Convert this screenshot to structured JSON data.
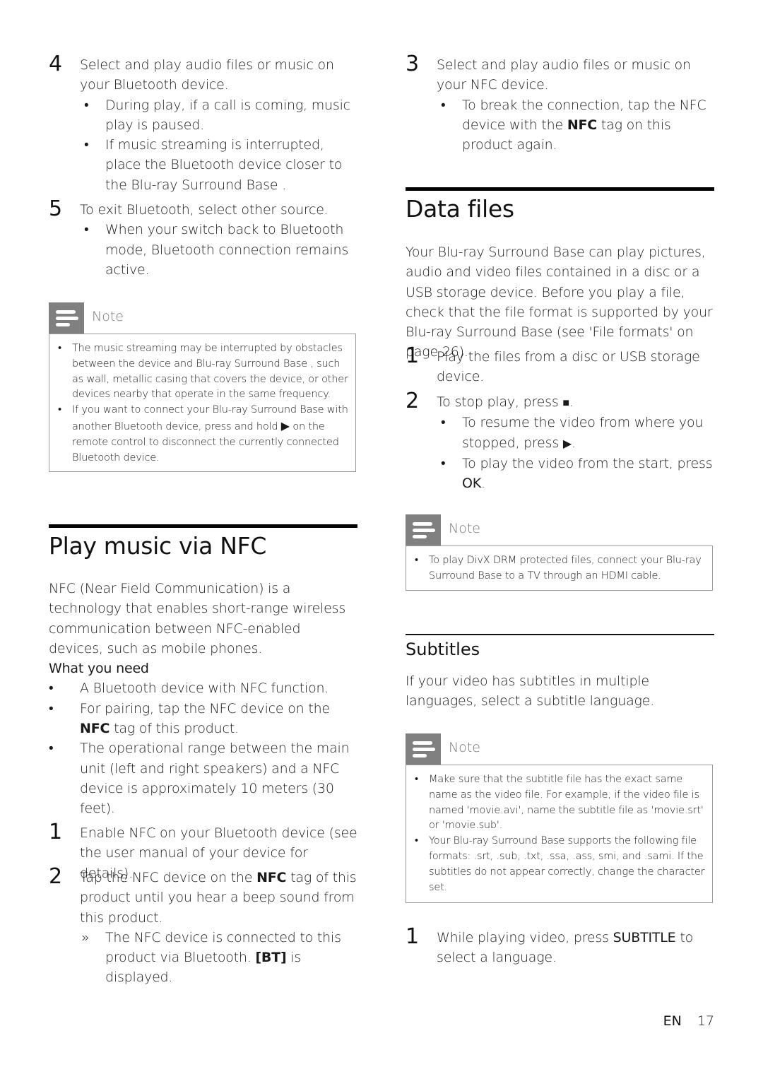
{
  "page": {
    "language_code": "EN",
    "page_number": "17"
  },
  "left": {
    "step4": {
      "num": "4",
      "text": "Select and play audio files or music on your Bluetooth device.",
      "bullets": [
        "During play, if a call is coming, music play is paused.",
        "If music streaming is interrupted, place the Bluetooth device closer to the Blu-ray Surround Base ."
      ]
    },
    "step5": {
      "num": "5",
      "text": "To exit Bluetooth, select other source.",
      "bullets": [
        "When your switch back to Bluetooth mode, Bluetooth connection remains active."
      ]
    },
    "note1": {
      "label": "Note",
      "icon": "note-icon",
      "items": [
        "The music streaming may be interrupted by obstacles between the device and Blu-ray Surround Base , such as wall, metallic casing that covers the device, or other devices nearby that operate in the same frequency.",
        {
          "before": "If you want to connect your Blu-ray Surround Base with another Bluetooth device, press and hold ",
          "symbol": "▶",
          "after": " on the remote control to disconnect the currently connected Bluetooth device."
        }
      ]
    },
    "nfc_section": {
      "title": "Play music via NFC",
      "intro": "NFC (Near Field Communication) is a technology that enables short-range wireless communication between NFC-enabled devices, such as mobile phones.",
      "need_heading": "What you need",
      "needs": [
        "A Bluetooth device with NFC function.",
        {
          "before": "For pairing, tap the NFC device on the ",
          "bold": "NFC",
          "after": " tag of this product."
        },
        "The operational range between the main unit (left and right speakers) and a NFC device is approximately 10 meters (30 feet)."
      ],
      "steps": [
        {
          "num": "1",
          "text": "Enable NFC on your Bluetooth device (see the user manual of your device for details)."
        },
        {
          "num": "2",
          "before": "Tap the NFC device on the ",
          "bold": "NFC",
          "after": " tag of this product until you hear a beep sound from this product.",
          "result_marker": "»",
          "result_before": "The NFC device is connected to this product via Bluetooth. ",
          "result_bold": "[BT]",
          "result_after": " is displayed."
        }
      ]
    }
  },
  "right": {
    "step3": {
      "num": "3",
      "text": "Select and play audio files or music on your NFC device.",
      "bullet_before": "To break the connection, tap the NFC device with the ",
      "bullet_bold": "NFC",
      "bullet_after": " tag on this product again."
    },
    "data_files": {
      "title": "Data files",
      "intro": "Your Blu-ray Surround Base  can play pictures, audio and video files contained in a disc or a USB storage device. Before you play a file, check that the file format is supported by your Blu-ray Surround Base  (see 'File formats' on page 26).",
      "steps": [
        {
          "num": "1",
          "text": "Play the files from a disc or USB storage device."
        },
        {
          "num": "2",
          "before": "To stop play, press ",
          "symbol": "■",
          "after": ".",
          "bullets": [
            {
              "before": "To resume the video from where you stopped, press ",
              "symbol": "▶",
              "after": "."
            },
            {
              "before": "To play the video from the start, press ",
              "bold": "OK",
              "after": "."
            }
          ]
        }
      ],
      "note": {
        "label": "Note",
        "items": [
          "To play DivX DRM protected files, connect your Blu-ray Surround Base  to a TV through an HDMI cable."
        ]
      }
    },
    "subtitles": {
      "title": "Subtitles",
      "intro": "If your video has subtitles in multiple languages, select a subtitle language.",
      "note": {
        "label": "Note",
        "items": [
          "Make sure that the subtitle file has the exact same name as the video file. For example, if the video file is named 'movie.avi', name the subtitle file as 'movie.srt' or 'movie.sub'.",
          "Your Blu-ray Surround Base  supports the following file formats: .srt, .sub, .txt, .ssa, .ass, smi, and .sami. If the subtitles do not appear correctly, change the character set."
        ]
      },
      "step": {
        "num": "1",
        "before": "While playing video, press ",
        "bold": "SUBTITLE",
        "after": " to select a language."
      }
    }
  }
}
